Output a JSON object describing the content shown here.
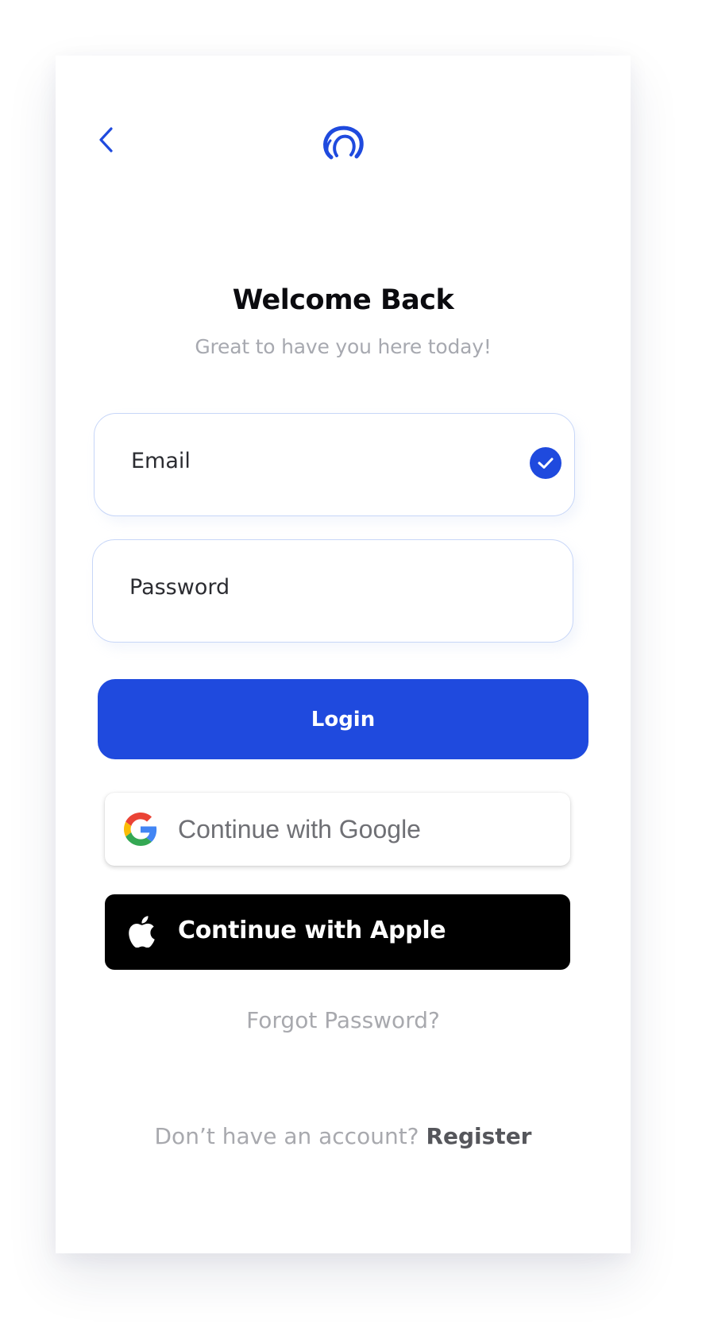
{
  "header": {
    "back_icon": "chevron-left-icon",
    "logo_icon": "brand-swirl-logo"
  },
  "welcome": {
    "title": "Welcome Back",
    "subtitle": "Great to have you here today!"
  },
  "form": {
    "email_label": "Email",
    "email_valid_icon": "check-circle-icon",
    "password_label": "Password",
    "login_label": "Login"
  },
  "social": {
    "google_label": "Continue with Google",
    "google_icon": "google-g-icon",
    "apple_label": "Continue with Apple",
    "apple_icon": "apple-logo-icon"
  },
  "footer": {
    "forgot_label": "Forgot Password?",
    "no_account_text": "Don’t have an account?",
    "register_label": "Register"
  },
  "colors": {
    "accent": "#1f4ade",
    "apple_bg": "#000000",
    "muted_text": "#a8a9ae",
    "field_border": "#c7d6f8"
  }
}
